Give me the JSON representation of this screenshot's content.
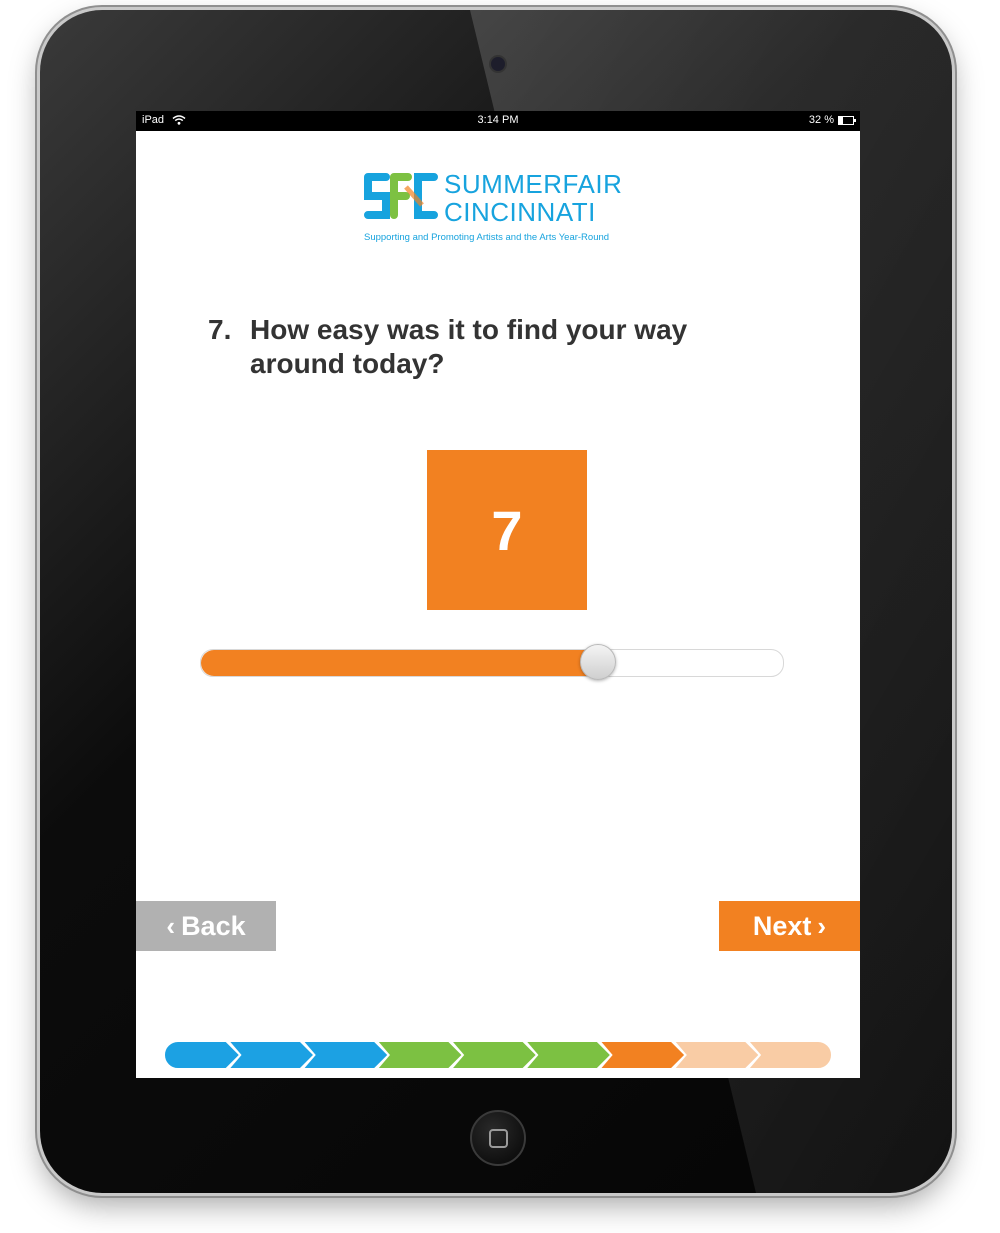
{
  "statusbar": {
    "device": "iPad",
    "time": "3:14 PM",
    "battery": "32 %"
  },
  "logo": {
    "line1": "SUMMERFAIR",
    "line2": "CINCINNATI",
    "tagline": "Supporting and Promoting Artists and the Arts Year-Round"
  },
  "question": {
    "number": "7.",
    "text": "How easy was it to find your way around today?"
  },
  "answer": {
    "value": "7"
  },
  "slider": {
    "fraction": 0.68
  },
  "nav": {
    "back_label": "Back",
    "next_label": "Next"
  },
  "colors": {
    "accent": "#f28121",
    "brand_blue": "#17a3de",
    "brand_green": "#7dc142",
    "back_gray": "#b1b1b1"
  },
  "progress": {
    "steps": [
      {
        "color": "#1ca1e3"
      },
      {
        "color": "#1ca1e3"
      },
      {
        "color": "#1ca1e3"
      },
      {
        "color": "#7cc142"
      },
      {
        "color": "#7cc142"
      },
      {
        "color": "#7cc142"
      },
      {
        "color": "#f28121"
      },
      {
        "color": "#f9cca5"
      },
      {
        "color": "#f9cca5"
      }
    ]
  }
}
